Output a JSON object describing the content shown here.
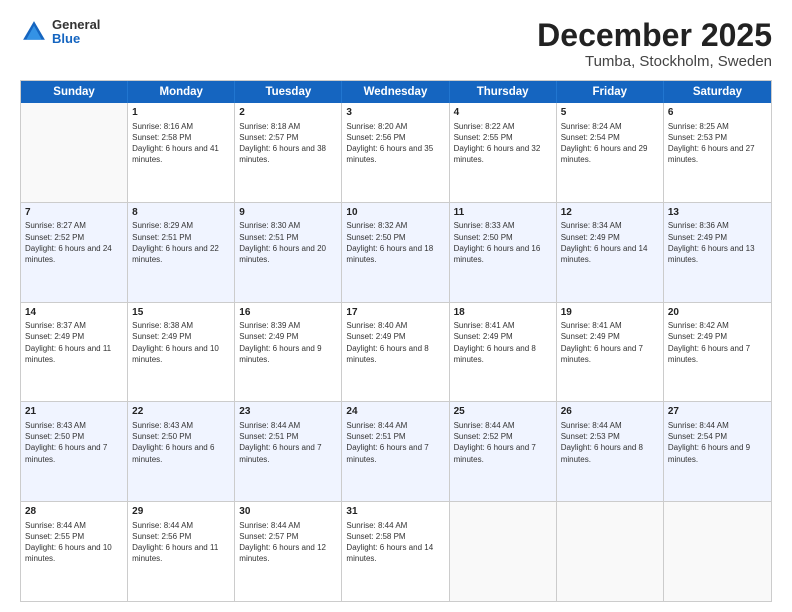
{
  "header": {
    "logo_general": "General",
    "logo_blue": "Blue",
    "title": "December 2025",
    "location": "Tumba, Stockholm, Sweden"
  },
  "days_of_week": [
    "Sunday",
    "Monday",
    "Tuesday",
    "Wednesday",
    "Thursday",
    "Friday",
    "Saturday"
  ],
  "weeks": [
    [
      {
        "day": "",
        "sunrise": "",
        "sunset": "",
        "daylight": ""
      },
      {
        "day": "1",
        "sunrise": "Sunrise: 8:16 AM",
        "sunset": "Sunset: 2:58 PM",
        "daylight": "Daylight: 6 hours and 41 minutes."
      },
      {
        "day": "2",
        "sunrise": "Sunrise: 8:18 AM",
        "sunset": "Sunset: 2:57 PM",
        "daylight": "Daylight: 6 hours and 38 minutes."
      },
      {
        "day": "3",
        "sunrise": "Sunrise: 8:20 AM",
        "sunset": "Sunset: 2:56 PM",
        "daylight": "Daylight: 6 hours and 35 minutes."
      },
      {
        "day": "4",
        "sunrise": "Sunrise: 8:22 AM",
        "sunset": "Sunset: 2:55 PM",
        "daylight": "Daylight: 6 hours and 32 minutes."
      },
      {
        "day": "5",
        "sunrise": "Sunrise: 8:24 AM",
        "sunset": "Sunset: 2:54 PM",
        "daylight": "Daylight: 6 hours and 29 minutes."
      },
      {
        "day": "6",
        "sunrise": "Sunrise: 8:25 AM",
        "sunset": "Sunset: 2:53 PM",
        "daylight": "Daylight: 6 hours and 27 minutes."
      }
    ],
    [
      {
        "day": "7",
        "sunrise": "Sunrise: 8:27 AM",
        "sunset": "Sunset: 2:52 PM",
        "daylight": "Daylight: 6 hours and 24 minutes."
      },
      {
        "day": "8",
        "sunrise": "Sunrise: 8:29 AM",
        "sunset": "Sunset: 2:51 PM",
        "daylight": "Daylight: 6 hours and 22 minutes."
      },
      {
        "day": "9",
        "sunrise": "Sunrise: 8:30 AM",
        "sunset": "Sunset: 2:51 PM",
        "daylight": "Daylight: 6 hours and 20 minutes."
      },
      {
        "day": "10",
        "sunrise": "Sunrise: 8:32 AM",
        "sunset": "Sunset: 2:50 PM",
        "daylight": "Daylight: 6 hours and 18 minutes."
      },
      {
        "day": "11",
        "sunrise": "Sunrise: 8:33 AM",
        "sunset": "Sunset: 2:50 PM",
        "daylight": "Daylight: 6 hours and 16 minutes."
      },
      {
        "day": "12",
        "sunrise": "Sunrise: 8:34 AM",
        "sunset": "Sunset: 2:49 PM",
        "daylight": "Daylight: 6 hours and 14 minutes."
      },
      {
        "day": "13",
        "sunrise": "Sunrise: 8:36 AM",
        "sunset": "Sunset: 2:49 PM",
        "daylight": "Daylight: 6 hours and 13 minutes."
      }
    ],
    [
      {
        "day": "14",
        "sunrise": "Sunrise: 8:37 AM",
        "sunset": "Sunset: 2:49 PM",
        "daylight": "Daylight: 6 hours and 11 minutes."
      },
      {
        "day": "15",
        "sunrise": "Sunrise: 8:38 AM",
        "sunset": "Sunset: 2:49 PM",
        "daylight": "Daylight: 6 hours and 10 minutes."
      },
      {
        "day": "16",
        "sunrise": "Sunrise: 8:39 AM",
        "sunset": "Sunset: 2:49 PM",
        "daylight": "Daylight: 6 hours and 9 minutes."
      },
      {
        "day": "17",
        "sunrise": "Sunrise: 8:40 AM",
        "sunset": "Sunset: 2:49 PM",
        "daylight": "Daylight: 6 hours and 8 minutes."
      },
      {
        "day": "18",
        "sunrise": "Sunrise: 8:41 AM",
        "sunset": "Sunset: 2:49 PM",
        "daylight": "Daylight: 6 hours and 8 minutes."
      },
      {
        "day": "19",
        "sunrise": "Sunrise: 8:41 AM",
        "sunset": "Sunset: 2:49 PM",
        "daylight": "Daylight: 6 hours and 7 minutes."
      },
      {
        "day": "20",
        "sunrise": "Sunrise: 8:42 AM",
        "sunset": "Sunset: 2:49 PM",
        "daylight": "Daylight: 6 hours and 7 minutes."
      }
    ],
    [
      {
        "day": "21",
        "sunrise": "Sunrise: 8:43 AM",
        "sunset": "Sunset: 2:50 PM",
        "daylight": "Daylight: 6 hours and 7 minutes."
      },
      {
        "day": "22",
        "sunrise": "Sunrise: 8:43 AM",
        "sunset": "Sunset: 2:50 PM",
        "daylight": "Daylight: 6 hours and 6 minutes."
      },
      {
        "day": "23",
        "sunrise": "Sunrise: 8:44 AM",
        "sunset": "Sunset: 2:51 PM",
        "daylight": "Daylight: 6 hours and 7 minutes."
      },
      {
        "day": "24",
        "sunrise": "Sunrise: 8:44 AM",
        "sunset": "Sunset: 2:51 PM",
        "daylight": "Daylight: 6 hours and 7 minutes."
      },
      {
        "day": "25",
        "sunrise": "Sunrise: 8:44 AM",
        "sunset": "Sunset: 2:52 PM",
        "daylight": "Daylight: 6 hours and 7 minutes."
      },
      {
        "day": "26",
        "sunrise": "Sunrise: 8:44 AM",
        "sunset": "Sunset: 2:53 PM",
        "daylight": "Daylight: 6 hours and 8 minutes."
      },
      {
        "day": "27",
        "sunrise": "Sunrise: 8:44 AM",
        "sunset": "Sunset: 2:54 PM",
        "daylight": "Daylight: 6 hours and 9 minutes."
      }
    ],
    [
      {
        "day": "28",
        "sunrise": "Sunrise: 8:44 AM",
        "sunset": "Sunset: 2:55 PM",
        "daylight": "Daylight: 6 hours and 10 minutes."
      },
      {
        "day": "29",
        "sunrise": "Sunrise: 8:44 AM",
        "sunset": "Sunset: 2:56 PM",
        "daylight": "Daylight: 6 hours and 11 minutes."
      },
      {
        "day": "30",
        "sunrise": "Sunrise: 8:44 AM",
        "sunset": "Sunset: 2:57 PM",
        "daylight": "Daylight: 6 hours and 12 minutes."
      },
      {
        "day": "31",
        "sunrise": "Sunrise: 8:44 AM",
        "sunset": "Sunset: 2:58 PM",
        "daylight": "Daylight: 6 hours and 14 minutes."
      },
      {
        "day": "",
        "sunrise": "",
        "sunset": "",
        "daylight": ""
      },
      {
        "day": "",
        "sunrise": "",
        "sunset": "",
        "daylight": ""
      },
      {
        "day": "",
        "sunrise": "",
        "sunset": "",
        "daylight": ""
      }
    ]
  ]
}
